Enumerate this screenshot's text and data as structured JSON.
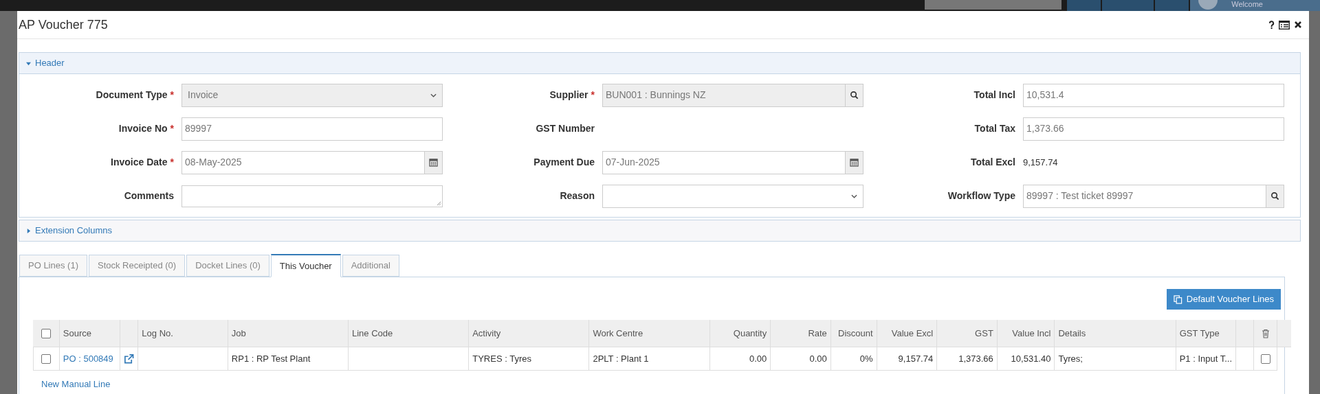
{
  "backdrop": {
    "welcome": "Welcome"
  },
  "dialog": {
    "title": "AP Voucher 775"
  },
  "header_section": {
    "label": "Header",
    "expanded": true
  },
  "fields": [
    {
      "kind": "select",
      "label": "Document Type",
      "required_mark": "*",
      "value": "Invoice",
      "disabled": true
    },
    {
      "kind": "lookup",
      "label": "Supplier",
      "required_mark": "*",
      "value": "BUN001 : Bunnings NZ",
      "disabled": true
    },
    {
      "kind": "text",
      "label": "Total Incl",
      "value": "10,531.4",
      "disabled": false
    },
    {
      "kind": "text",
      "label": "Invoice No",
      "required_mark": "*",
      "value": "89997",
      "disabled": false
    },
    {
      "kind": "static",
      "label": "GST Number"
    },
    {
      "kind": "text",
      "label": "Total Tax",
      "value": "1,373.66",
      "disabled": false
    },
    {
      "kind": "date",
      "label": "Invoice Date",
      "required_mark": "*",
      "value": "08-May-2025",
      "disabled": false
    },
    {
      "kind": "date",
      "label": "Payment Due",
      "value": "07-Jun-2025",
      "disabled": false
    },
    {
      "kind": "static",
      "label": "Total Excl",
      "value": "9,157.74"
    },
    {
      "kind": "textarea",
      "label": "Comments",
      "disabled": false
    },
    {
      "kind": "select",
      "label": "Reason",
      "disabled": false
    },
    {
      "kind": "lookup",
      "label": "Workflow Type",
      "value": "89997 : Test ticket 89997",
      "disabled": false
    }
  ],
  "extension_section": {
    "label": "Extension Columns",
    "expanded": false
  },
  "tabs": [
    {
      "label": "PO Lines (1)",
      "selected": false
    },
    {
      "label": "Stock Receipted (0)",
      "selected": false
    },
    {
      "label": "Docket Lines (0)",
      "selected": false
    },
    {
      "label": "This Voucher",
      "selected": true
    },
    {
      "label": "Additional",
      "selected": false
    }
  ],
  "default_button": "Default Voucher Lines",
  "table": {
    "select_all_checked": false,
    "columns": [
      "Source",
      "",
      "Log No.",
      "Job",
      "Line Code",
      "Activity",
      "Work Centre",
      "Quantity",
      "Rate",
      "Discount",
      "Value Excl",
      "GST",
      "Value Incl",
      "Details",
      "GST Type"
    ],
    "rows": [
      {
        "checked": false,
        "source": "PO : 500849",
        "log_no": "",
        "job": "RP1 : RP Test Plant",
        "line_code": "",
        "activity": "TYRES : Tyres",
        "work_centre": "2PLT : Plant 1",
        "quantity": "0.00",
        "rate": "0.00",
        "discount": "0%",
        "value_excl": "9,157.74",
        "gst": "1,373.66",
        "value_incl": "10,531.40",
        "details": "Tyres;",
        "gst_type": "P1 : Input T...",
        "delete_checked": false
      }
    ]
  },
  "new_line_link": "New Manual Line"
}
